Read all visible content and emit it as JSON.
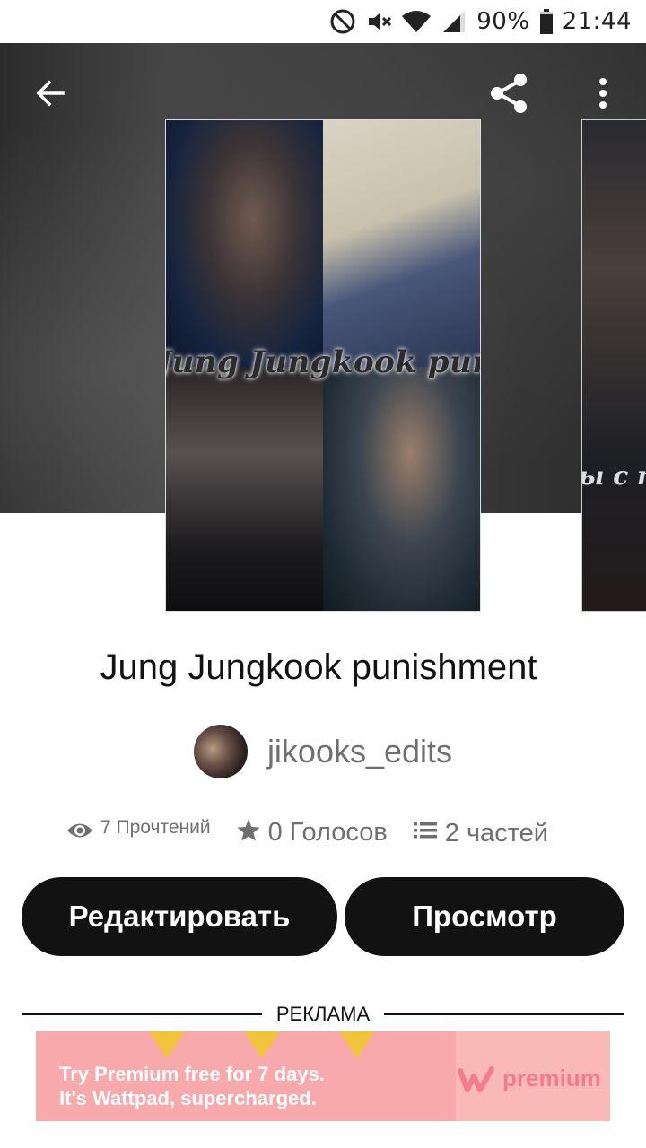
{
  "status_bar": {
    "battery": "90%",
    "time": "21:44"
  },
  "story": {
    "title": "Jung Jungkook punishment",
    "cover_text": "Jung Jungkook punishment",
    "next_cover_text": "ы с п",
    "author": "jikooks_edits",
    "reads": "7 Прочтений",
    "votes": "0 Голосов",
    "parts": "2 частей"
  },
  "buttons": {
    "edit": "Редактировать",
    "preview": "Просмотр"
  },
  "ad": {
    "label": "РЕКЛАМА",
    "line1": "Try Premium free for 7 days.",
    "line2": "It's Wattpad, supercharged.",
    "brand": "premium"
  }
}
